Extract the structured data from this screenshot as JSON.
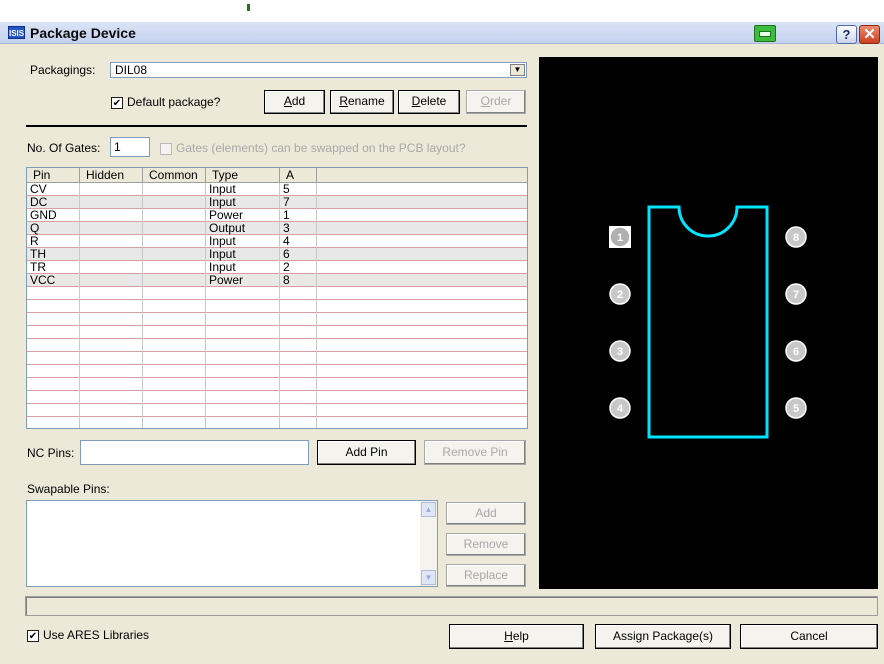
{
  "window": {
    "title": "Package Device",
    "app_icon_text": "ISIS",
    "help_glyph": "?",
    "close_glyph": "✕",
    "icons": {
      "app": "isis-app-icon",
      "printer": "printer-icon",
      "help": "question-icon",
      "close": "close-icon"
    }
  },
  "packaging": {
    "label": "Packagings:",
    "selected": "DIL08",
    "dropdown_arrow": "▼",
    "default_checkbox_label": "Default package?",
    "default_checked": true,
    "check_glyph": "✔",
    "buttons": {
      "add": {
        "prefix": "",
        "key": "A",
        "rest": "dd"
      },
      "rename": {
        "prefix": "",
        "key": "R",
        "rest": "ename"
      },
      "delete": {
        "prefix": "",
        "key": "D",
        "rest": "elete"
      },
      "order": {
        "prefix": "",
        "key": "O",
        "rest": "rder",
        "disabled": true
      }
    }
  },
  "gates": {
    "label": "No. Of Gates:",
    "value": "1",
    "swap_label": "Gates (elements) can be swapped on the PCB layout?",
    "swap_checked": false,
    "swap_disabled": true
  },
  "pin_table": {
    "columns": [
      "Pin",
      "Hidden",
      "Common",
      "Type",
      "A"
    ],
    "rows": [
      {
        "pin": "CV",
        "hidden": "",
        "common": "",
        "type": "Input",
        "a": "5"
      },
      {
        "pin": "DC",
        "hidden": "",
        "common": "",
        "type": "Input",
        "a": "7"
      },
      {
        "pin": "GND",
        "hidden": "",
        "common": "",
        "type": "Power",
        "a": "1"
      },
      {
        "pin": "Q",
        "hidden": "",
        "common": "",
        "type": "Output",
        "a": "3"
      },
      {
        "pin": "R",
        "hidden": "",
        "common": "",
        "type": "Input",
        "a": "4"
      },
      {
        "pin": "TH",
        "hidden": "",
        "common": "",
        "type": "Input",
        "a": "6"
      },
      {
        "pin": "TR",
        "hidden": "",
        "common": "",
        "type": "Input",
        "a": "2"
      },
      {
        "pin": "VCC",
        "hidden": "",
        "common": "",
        "type": "Power",
        "a": "8"
      }
    ],
    "empty_rows": 10
  },
  "nc_pins": {
    "label": "NC Pins:",
    "value": "",
    "add_pin": "Add Pin",
    "remove_pin": "Remove Pin"
  },
  "swapable": {
    "label": "Swapable Pins:",
    "value": "",
    "scroll_up": "▲",
    "scroll_down": "▼",
    "add": "Add",
    "remove": "Remove",
    "replace": "Replace"
  },
  "preview": {
    "pads": [
      "1",
      "2",
      "3",
      "4",
      "5",
      "6",
      "7",
      "8"
    ],
    "selected_pad": "1",
    "outline_color": "#00e5ff",
    "pad_color": "#c8c8c8"
  },
  "footer": {
    "use_ares_label": "Use ARES Libraries",
    "use_ares_checked": true,
    "help": {
      "prefix": "",
      "key": "H",
      "rest": "elp"
    },
    "assign": "Assign Package(s)",
    "cancel": "Cancel"
  }
}
